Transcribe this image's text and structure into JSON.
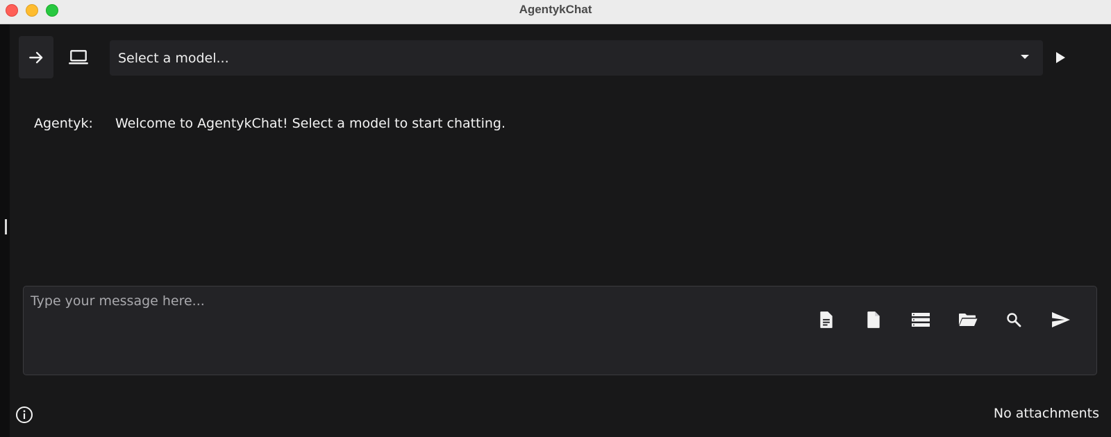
{
  "window": {
    "title": "AgentykChat"
  },
  "toolbar": {
    "arrow_icon": "arrow-right-icon",
    "laptop_icon": "laptop-icon",
    "play_icon": "play-icon",
    "model_select": {
      "placeholder": "Select a model..."
    }
  },
  "messages": [
    {
      "sender": "Agentyk:",
      "text": "Welcome to AgentykChat! Select a model to start chatting."
    }
  ],
  "composer": {
    "placeholder": "Type your message here...",
    "tools": [
      "document-icon",
      "file-icon",
      "list-icon",
      "folder-open-icon",
      "search-icon",
      "send-icon"
    ]
  },
  "footer": {
    "info_icon": "info-icon",
    "attachments": "No attachments"
  },
  "colors": {
    "background": "#181819",
    "surface": "#232326",
    "titlebar": "#ececec",
    "text": "#f0f0f0"
  }
}
